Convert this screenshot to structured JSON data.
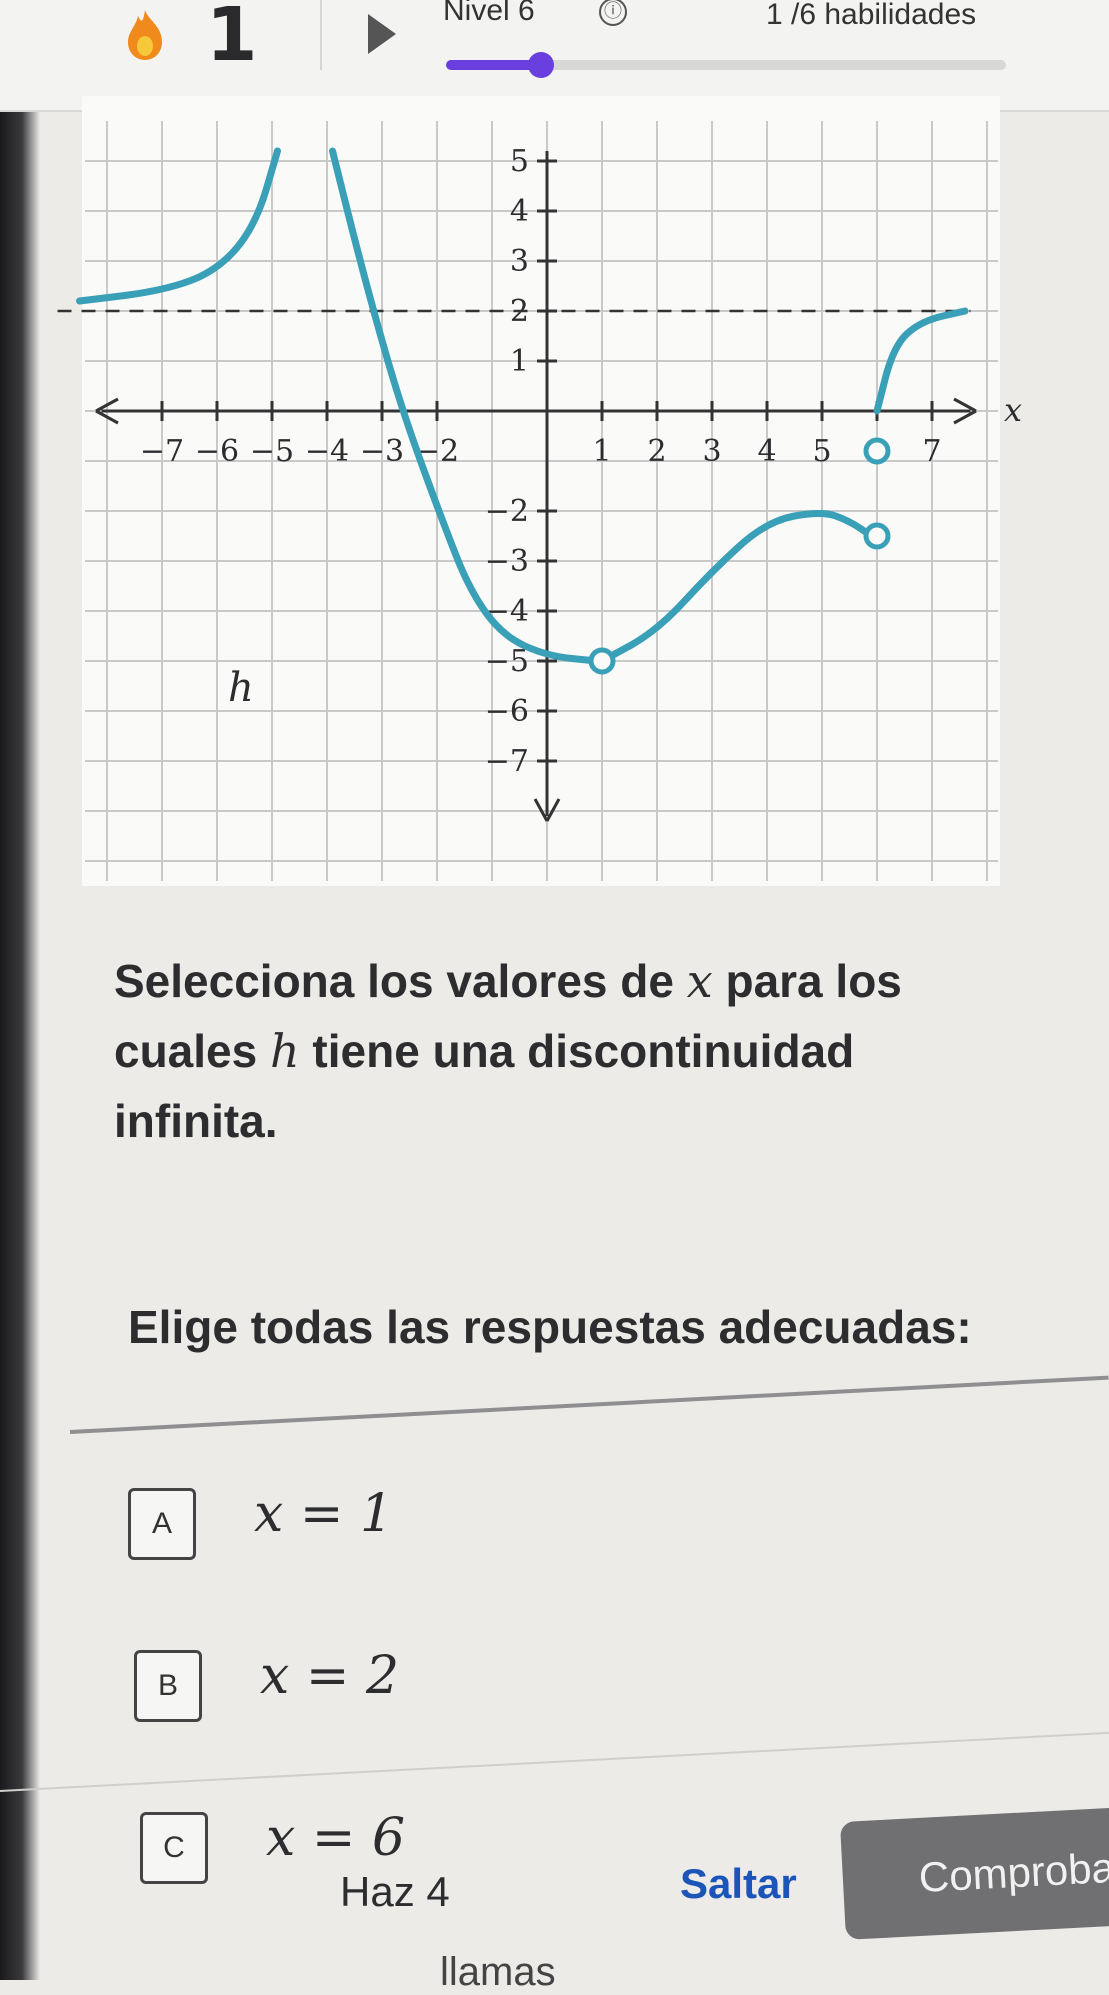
{
  "header": {
    "streak_count": "1",
    "level_label": "Nivel 6",
    "info_icon": "ⓘ",
    "skills_progress": "1 /6 habilidades",
    "progress_fraction": 0.16,
    "accent_color": "#6a3fe0",
    "streak_icon": "flame-icon"
  },
  "chart_data": {
    "type": "line",
    "function_label": "h",
    "xlabel": "x",
    "ylabel": "",
    "x_ticks": [
      "−7",
      "−6",
      "−5",
      "−4",
      "−3",
      "−2",
      "1",
      "2",
      "3",
      "4",
      "5",
      "6",
      "7"
    ],
    "y_ticks": [
      "5",
      "4",
      "3",
      "2",
      "1",
      "−2",
      "−3",
      "−4",
      "−5",
      "−6",
      "−7"
    ],
    "xlim": [
      -8,
      8
    ],
    "ylim": [
      -8,
      5
    ],
    "grid": true,
    "asymptotes": [
      {
        "type": "horizontal",
        "y": 2
      },
      {
        "type": "vertical",
        "x": -4.5
      }
    ],
    "series": [
      {
        "values": [
          [
            -8.5,
            2.2
          ],
          [
            -7,
            2.4
          ],
          [
            -6,
            2.8
          ],
          [
            -5.3,
            3.7
          ],
          [
            -4.9,
            5.2
          ]
        ]
      },
      {
        "values": [
          [
            -3.9,
            5.2
          ],
          [
            -3.4,
            3
          ],
          [
            -2.9,
            1
          ],
          [
            -2.5,
            -0.4
          ],
          [
            -1.9,
            -2.2
          ],
          [
            -1.4,
            -3.6
          ],
          [
            -0.8,
            -4.5
          ],
          [
            0,
            -4.9
          ],
          [
            0.9,
            -5
          ]
        ]
      },
      {
        "values": [
          [
            1,
            -5
          ],
          [
            2,
            -4.4
          ],
          [
            3,
            -3.2
          ],
          [
            4,
            -2.2
          ],
          [
            5,
            -2
          ],
          [
            5.5,
            -2.2
          ],
          [
            5.9,
            -2.5
          ]
        ]
      },
      {
        "values": [
          [
            6,
            0
          ],
          [
            6.3,
            1.3
          ],
          [
            6.8,
            1.8
          ],
          [
            7.6,
            2
          ]
        ]
      }
    ],
    "open_points": [
      [
        1,
        -5
      ],
      [
        6,
        -2.5
      ],
      [
        6,
        -0.8
      ]
    ],
    "curve_color": "#3aa0b7"
  },
  "question": {
    "line1_a": "Selecciona los valores de ",
    "var_x": "x",
    "line1_b": " para los",
    "line2_a": "cuales ",
    "var_h": "h",
    "line2_b": " tiene una discontinuidad",
    "line3": "infinita."
  },
  "instruction": "Elige todas las respuestas adecuadas:",
  "options": [
    {
      "letter": "A",
      "text": "x = 1"
    },
    {
      "letter": "B",
      "text": "x = 2"
    },
    {
      "letter": "C",
      "text": "x = 6"
    }
  ],
  "footer": {
    "streak_text": "Haz 4",
    "skip_label": "Saltar",
    "check_label": "Comprobar",
    "bottom_cut": "llamas"
  }
}
